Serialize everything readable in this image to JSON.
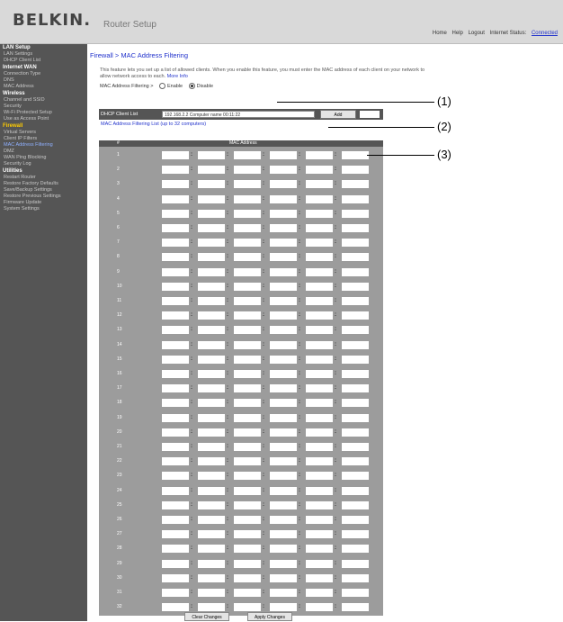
{
  "header": {
    "logo": "BELKIN.",
    "subtitle": "Router Setup",
    "links": [
      "Home",
      "Help",
      "Logout",
      "Internet Status:",
      "Connected"
    ]
  },
  "sidebar": [
    {
      "t": "head",
      "label": "LAN Setup"
    },
    {
      "t": "item",
      "label": "LAN Settings"
    },
    {
      "t": "item",
      "label": "DHCP Client List"
    },
    {
      "t": "head",
      "label": "Internet WAN"
    },
    {
      "t": "item",
      "label": "Connection Type"
    },
    {
      "t": "item",
      "label": "DNS"
    },
    {
      "t": "item",
      "label": "MAC Address"
    },
    {
      "t": "head",
      "label": "Wireless"
    },
    {
      "t": "item",
      "label": "Channel and SSID"
    },
    {
      "t": "item",
      "label": "Security"
    },
    {
      "t": "item",
      "label": "Wi-Fi Protected Setup"
    },
    {
      "t": "item",
      "label": "Use as Access Point"
    },
    {
      "t": "head",
      "label": "Firewall",
      "fire": true
    },
    {
      "t": "item",
      "label": "Virtual Servers"
    },
    {
      "t": "item",
      "label": "Client IP Filters"
    },
    {
      "t": "item",
      "label": "MAC Address Filtering",
      "active": true
    },
    {
      "t": "item",
      "label": "DMZ"
    },
    {
      "t": "item",
      "label": "WAN Ping Blocking"
    },
    {
      "t": "item",
      "label": "Security Log"
    },
    {
      "t": "head",
      "label": "Utilities"
    },
    {
      "t": "item",
      "label": "Restart Router"
    },
    {
      "t": "item",
      "label": "Restore Factory Defaults"
    },
    {
      "t": "item",
      "label": "Save/Backup Settings"
    },
    {
      "t": "item",
      "label": "Restore Previous Settings"
    },
    {
      "t": "item",
      "label": "Firmware Update"
    },
    {
      "t": "item",
      "label": "System Settings"
    }
  ],
  "page": {
    "title": "Firewall > MAC Address Filtering",
    "desc1": "This feature lets you set up a list of allowed clients. When you enable this feature, you must enter the MAC address of each client",
    "desc2": "on your network to allow network access to each.",
    "more_info": "More Info",
    "filter_label": "MAC Address Filtering >",
    "enable": "Enable",
    "disable": "Disable",
    "block_label": "DHCP Client List",
    "block_select": "192.168.2.2   Computer name   00:11:22",
    "block_btn": "Add",
    "dhcp_link": "MAC Address Filtering List (up to 32 computers)",
    "table_head_no": "#",
    "table_head_mac": "MAC Address",
    "apply": "Clear Changes",
    "save": "Apply Changes"
  },
  "callouts": [
    "(1)",
    "(2)",
    "(3)"
  ],
  "rows": [
    "1",
    "2",
    "3",
    "4",
    "5",
    "6",
    "7",
    "8",
    "9",
    "10",
    "11",
    "12",
    "13",
    "14",
    "15",
    "16",
    "17",
    "18",
    "19",
    "20",
    "21",
    "22",
    "23",
    "24",
    "25",
    "26",
    "27",
    "28",
    "29",
    "30",
    "31",
    "32"
  ]
}
